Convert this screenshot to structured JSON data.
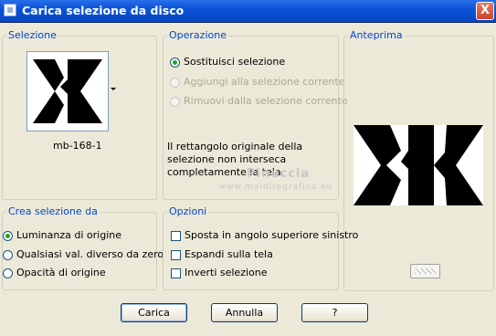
{
  "window": {
    "title": "Carica selezione da disco",
    "close_label": "X"
  },
  "selezione": {
    "label": "Selezione",
    "file_name": "mb-168-1"
  },
  "operazione": {
    "label": "Operazione",
    "options": [
      {
        "label": "Sostituisci selezione",
        "selected": true,
        "enabled": true
      },
      {
        "label": "Aggiungi alla selezione corrente",
        "selected": false,
        "enabled": false
      },
      {
        "label": "Rimuovi dalla selezione corrente",
        "selected": false,
        "enabled": false
      }
    ],
    "message": "Il rettangolo originale della selezione non interseca completamente la tela."
  },
  "anteprima": {
    "label": "Anteprima"
  },
  "watermark": {
    "line1": "Pinuccia",
    "line2": "www.maidiregrafica.eu"
  },
  "crea_selezione": {
    "label": "Crea selezione da",
    "options": [
      {
        "label": "Luminanza di origine",
        "selected": true
      },
      {
        "label": "Qualsiasi val. diverso da zero",
        "selected": false
      },
      {
        "label": "Opacità di origine",
        "selected": false
      }
    ]
  },
  "opzioni": {
    "label": "Opzioni",
    "checkboxes": [
      {
        "label": "Sposta in angolo superiore sinistro",
        "checked": false
      },
      {
        "label": "Espandi sulla tela",
        "checked": false
      },
      {
        "label": "Inverti selezione",
        "checked": false
      }
    ]
  },
  "buttons": {
    "load": "Carica",
    "cancel": "Annulla",
    "help": "?"
  }
}
